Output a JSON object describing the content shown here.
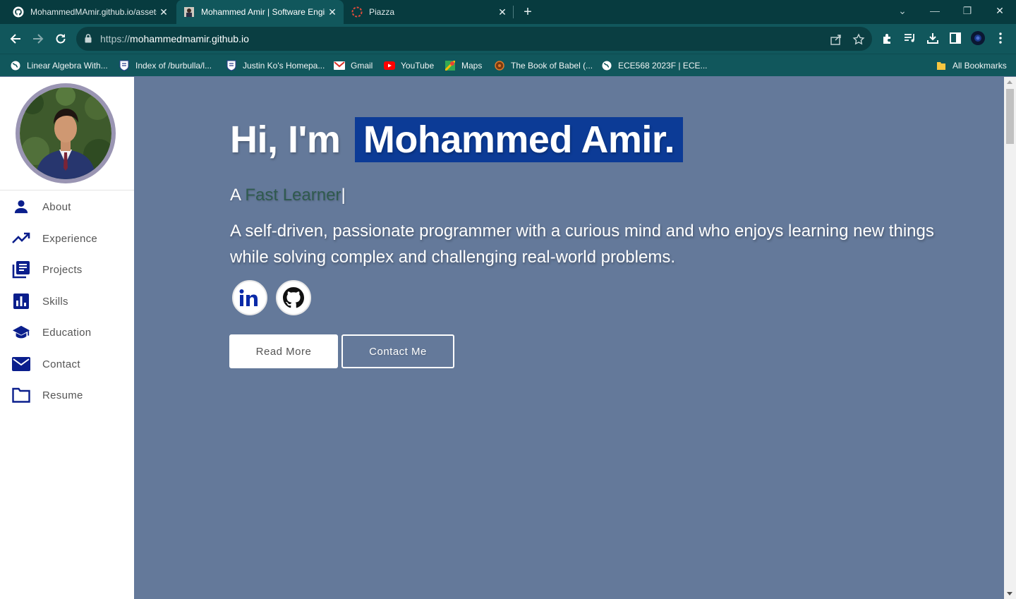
{
  "browser": {
    "tabs": [
      {
        "title": "MohammedMAmir.github.io/assets",
        "icon": "github-icon",
        "active": false
      },
      {
        "title": "Mohammed Amir | Software Engineer",
        "icon": "portrait-icon",
        "active": true
      },
      {
        "title": "Piazza",
        "icon": "piazza-icon",
        "active": false
      }
    ],
    "url_scheme": "https://",
    "url_host": "mohammedmamir.github.io",
    "bookmarks": [
      {
        "label": "Linear Algebra With...",
        "icon": "globe-icon"
      },
      {
        "label": "Index of /burbulla/l...",
        "icon": "crest-icon"
      },
      {
        "label": "Justin Ko's Homepa...",
        "icon": "crest-icon"
      },
      {
        "label": "Gmail",
        "icon": "gmail-icon"
      },
      {
        "label": "YouTube",
        "icon": "youtube-icon"
      },
      {
        "label": "Maps",
        "icon": "maps-icon"
      },
      {
        "label": "The Book of Babel (...",
        "icon": "babel-icon"
      },
      {
        "label": "ECE568 2023F | ECE...",
        "icon": "globe-icon"
      }
    ],
    "all_bookmarks": "All Bookmarks"
  },
  "sidebar": {
    "items": [
      {
        "label": "About",
        "icon": "person-icon"
      },
      {
        "label": "Experience",
        "icon": "trending-up-icon"
      },
      {
        "label": "Projects",
        "icon": "library-books-icon"
      },
      {
        "label": "Skills",
        "icon": "bar-chart-icon"
      },
      {
        "label": "Education",
        "icon": "graduation-cap-icon"
      },
      {
        "label": "Contact",
        "icon": "mail-icon"
      },
      {
        "label": "Resume",
        "icon": "folder-icon"
      }
    ]
  },
  "hero": {
    "greeting": "Hi, I'm",
    "name": "Mohammed Amir.",
    "tagline_prefix": "A",
    "tagline_typed": "Fast Learner",
    "tagline_cursor": "|",
    "bio": "A self-driven, passionate programmer with a curious mind and who enjoys learning new things while solving complex and challenging real-world problems.",
    "buttons": {
      "read_more": "Read More",
      "contact_me": "Contact Me"
    }
  },
  "colors": {
    "tabstrip": "#073b3f",
    "toolbar": "#11575c",
    "page_background": "#64799a",
    "name_highlight": "#0c3b96",
    "sidebar_icon": "#0a1e8c",
    "typed_text": "#2f5a4e"
  }
}
